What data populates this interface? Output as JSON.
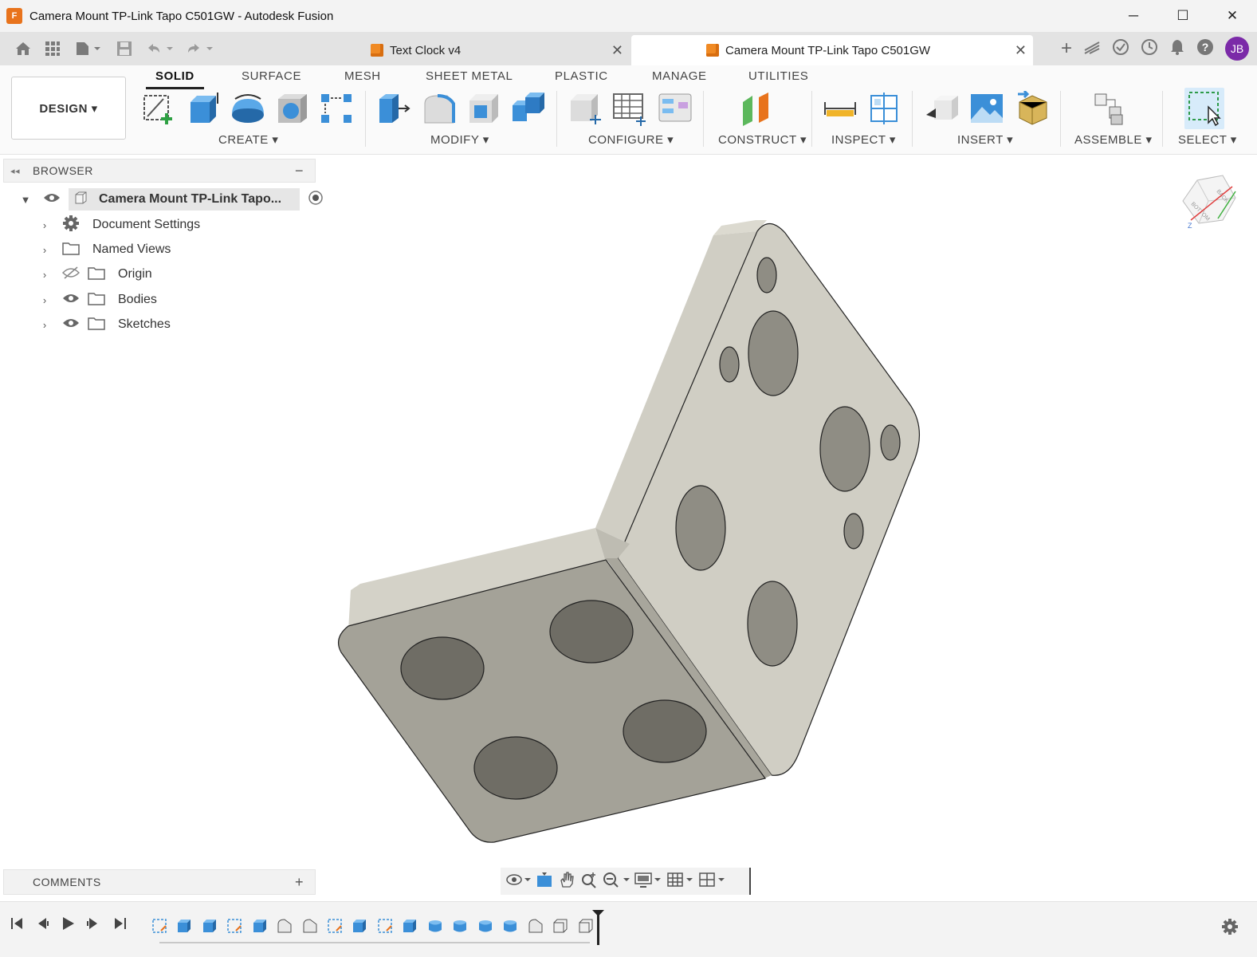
{
  "window": {
    "title": "Camera Mount TP-Link Tapo C501GW - Autodesk Fusion",
    "app_icon_letter": "F",
    "minimize_glyph": "─",
    "maximize_glyph": "☐",
    "close_glyph": "✕"
  },
  "tabs": [
    {
      "label": "Text Clock v4",
      "active": false
    },
    {
      "label": "Camera Mount TP-Link Tapo C501GW",
      "active": true
    }
  ],
  "tab_close_glyph": "✕",
  "new_tab_glyph": "+",
  "user": {
    "initials": "JB",
    "avatar_color": "#7b2aa8"
  },
  "workspace": {
    "label": "DESIGN ▾"
  },
  "ribbon_tabs": [
    "SOLID",
    "SURFACE",
    "MESH",
    "SHEET METAL",
    "PLASTIC",
    "MANAGE",
    "UTILITIES"
  ],
  "ribbon_groups": [
    "CREATE ▾",
    "MODIFY ▾",
    "CONFIGURE ▾",
    "CONSTRUCT ▾",
    "INSPECT ▾",
    "INSERT ▾",
    "ASSEMBLE ▾",
    "SELECT ▾"
  ],
  "browser": {
    "header": "BROWSER",
    "collapse_glyph": "◂◂",
    "minimize_glyph": "−",
    "root": "Camera Mount TP-Link Tapo...",
    "items": [
      "Document Settings",
      "Named Views",
      "Origin",
      "Bodies",
      "Sketches"
    ]
  },
  "comments": {
    "label": "COMMENTS",
    "add_glyph": "+"
  },
  "viewcube": {
    "faces": [
      "BACK",
      "BOTTOM"
    ],
    "axis_label": "Z"
  },
  "colors": {
    "accent": "#0696d7",
    "model_face_light": "#d2d0c6",
    "model_face_dark": "#9e9c92",
    "orange": "#f08a24"
  }
}
